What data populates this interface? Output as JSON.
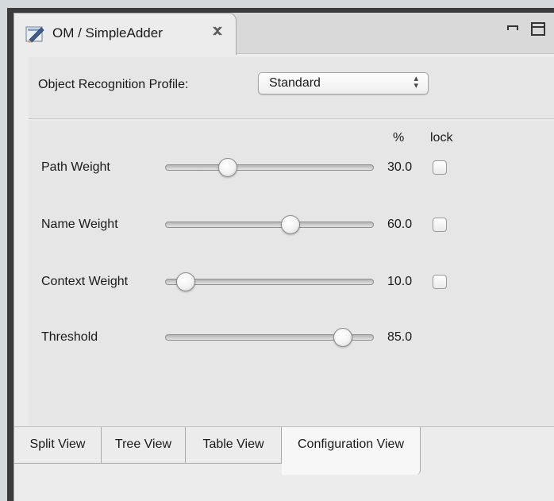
{
  "tab": {
    "title": "OM / SimpleAdder",
    "close_glyph": "✕",
    "icon": "om-editor-icon"
  },
  "window_controls": {
    "minimize": "minimize-icon",
    "maximize": "maximize-icon"
  },
  "profile": {
    "label": "Object Recognition Profile:",
    "selected": "Standard",
    "arrows": "⌃⌄"
  },
  "columns": {
    "percent": "%",
    "lock": "lock"
  },
  "weights": [
    {
      "label": "Path Weight",
      "value": "30.0",
      "fraction": 0.3,
      "lockable": true,
      "locked": false
    },
    {
      "label": "Name Weight",
      "value": "60.0",
      "fraction": 0.6,
      "lockable": true,
      "locked": false
    },
    {
      "label": "Context Weight",
      "value": "10.0",
      "fraction": 0.1,
      "lockable": true,
      "locked": false
    },
    {
      "label": "Threshold",
      "value": "85.0",
      "fraction": 0.85,
      "lockable": false,
      "locked": false
    }
  ],
  "view_tabs": [
    {
      "label": "Split View",
      "active": false
    },
    {
      "label": "Tree View",
      "active": false
    },
    {
      "label": "Table View",
      "active": false
    },
    {
      "label": "Configuration View",
      "active": true
    }
  ]
}
